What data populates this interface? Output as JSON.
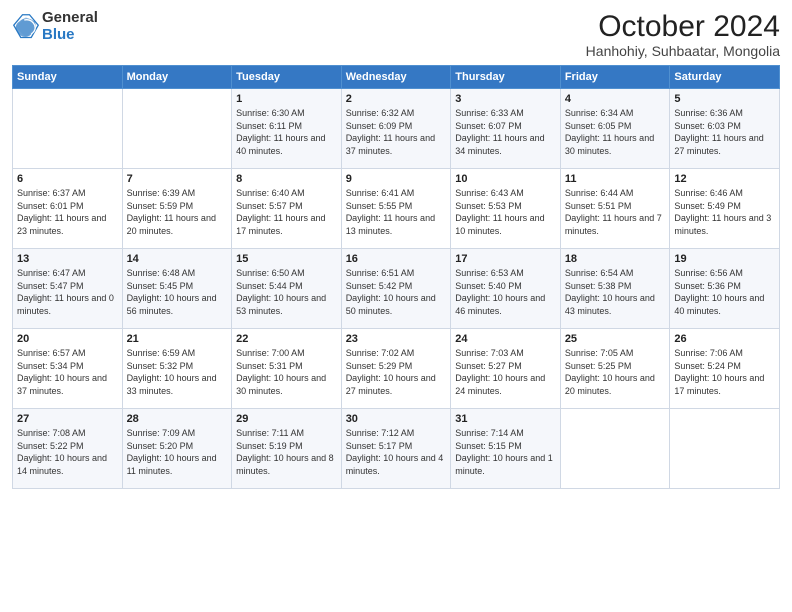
{
  "header": {
    "logo_general": "General",
    "logo_blue": "Blue",
    "title": "October 2024",
    "subtitle": "Hanhohiy, Suhbaatar, Mongolia"
  },
  "columns": [
    "Sunday",
    "Monday",
    "Tuesday",
    "Wednesday",
    "Thursday",
    "Friday",
    "Saturday"
  ],
  "weeks": [
    [
      {
        "day": "",
        "text": ""
      },
      {
        "day": "",
        "text": ""
      },
      {
        "day": "1",
        "text": "Sunrise: 6:30 AM\nSunset: 6:11 PM\nDaylight: 11 hours and 40 minutes."
      },
      {
        "day": "2",
        "text": "Sunrise: 6:32 AM\nSunset: 6:09 PM\nDaylight: 11 hours and 37 minutes."
      },
      {
        "day": "3",
        "text": "Sunrise: 6:33 AM\nSunset: 6:07 PM\nDaylight: 11 hours and 34 minutes."
      },
      {
        "day": "4",
        "text": "Sunrise: 6:34 AM\nSunset: 6:05 PM\nDaylight: 11 hours and 30 minutes."
      },
      {
        "day": "5",
        "text": "Sunrise: 6:36 AM\nSunset: 6:03 PM\nDaylight: 11 hours and 27 minutes."
      }
    ],
    [
      {
        "day": "6",
        "text": "Sunrise: 6:37 AM\nSunset: 6:01 PM\nDaylight: 11 hours and 23 minutes."
      },
      {
        "day": "7",
        "text": "Sunrise: 6:39 AM\nSunset: 5:59 PM\nDaylight: 11 hours and 20 minutes."
      },
      {
        "day": "8",
        "text": "Sunrise: 6:40 AM\nSunset: 5:57 PM\nDaylight: 11 hours and 17 minutes."
      },
      {
        "day": "9",
        "text": "Sunrise: 6:41 AM\nSunset: 5:55 PM\nDaylight: 11 hours and 13 minutes."
      },
      {
        "day": "10",
        "text": "Sunrise: 6:43 AM\nSunset: 5:53 PM\nDaylight: 11 hours and 10 minutes."
      },
      {
        "day": "11",
        "text": "Sunrise: 6:44 AM\nSunset: 5:51 PM\nDaylight: 11 hours and 7 minutes."
      },
      {
        "day": "12",
        "text": "Sunrise: 6:46 AM\nSunset: 5:49 PM\nDaylight: 11 hours and 3 minutes."
      }
    ],
    [
      {
        "day": "13",
        "text": "Sunrise: 6:47 AM\nSunset: 5:47 PM\nDaylight: 11 hours and 0 minutes."
      },
      {
        "day": "14",
        "text": "Sunrise: 6:48 AM\nSunset: 5:45 PM\nDaylight: 10 hours and 56 minutes."
      },
      {
        "day": "15",
        "text": "Sunrise: 6:50 AM\nSunset: 5:44 PM\nDaylight: 10 hours and 53 minutes."
      },
      {
        "day": "16",
        "text": "Sunrise: 6:51 AM\nSunset: 5:42 PM\nDaylight: 10 hours and 50 minutes."
      },
      {
        "day": "17",
        "text": "Sunrise: 6:53 AM\nSunset: 5:40 PM\nDaylight: 10 hours and 46 minutes."
      },
      {
        "day": "18",
        "text": "Sunrise: 6:54 AM\nSunset: 5:38 PM\nDaylight: 10 hours and 43 minutes."
      },
      {
        "day": "19",
        "text": "Sunrise: 6:56 AM\nSunset: 5:36 PM\nDaylight: 10 hours and 40 minutes."
      }
    ],
    [
      {
        "day": "20",
        "text": "Sunrise: 6:57 AM\nSunset: 5:34 PM\nDaylight: 10 hours and 37 minutes."
      },
      {
        "day": "21",
        "text": "Sunrise: 6:59 AM\nSunset: 5:32 PM\nDaylight: 10 hours and 33 minutes."
      },
      {
        "day": "22",
        "text": "Sunrise: 7:00 AM\nSunset: 5:31 PM\nDaylight: 10 hours and 30 minutes."
      },
      {
        "day": "23",
        "text": "Sunrise: 7:02 AM\nSunset: 5:29 PM\nDaylight: 10 hours and 27 minutes."
      },
      {
        "day": "24",
        "text": "Sunrise: 7:03 AM\nSunset: 5:27 PM\nDaylight: 10 hours and 24 minutes."
      },
      {
        "day": "25",
        "text": "Sunrise: 7:05 AM\nSunset: 5:25 PM\nDaylight: 10 hours and 20 minutes."
      },
      {
        "day": "26",
        "text": "Sunrise: 7:06 AM\nSunset: 5:24 PM\nDaylight: 10 hours and 17 minutes."
      }
    ],
    [
      {
        "day": "27",
        "text": "Sunrise: 7:08 AM\nSunset: 5:22 PM\nDaylight: 10 hours and 14 minutes."
      },
      {
        "day": "28",
        "text": "Sunrise: 7:09 AM\nSunset: 5:20 PM\nDaylight: 10 hours and 11 minutes."
      },
      {
        "day": "29",
        "text": "Sunrise: 7:11 AM\nSunset: 5:19 PM\nDaylight: 10 hours and 8 minutes."
      },
      {
        "day": "30",
        "text": "Sunrise: 7:12 AM\nSunset: 5:17 PM\nDaylight: 10 hours and 4 minutes."
      },
      {
        "day": "31",
        "text": "Sunrise: 7:14 AM\nSunset: 5:15 PM\nDaylight: 10 hours and 1 minute."
      },
      {
        "day": "",
        "text": ""
      },
      {
        "day": "",
        "text": ""
      }
    ]
  ]
}
